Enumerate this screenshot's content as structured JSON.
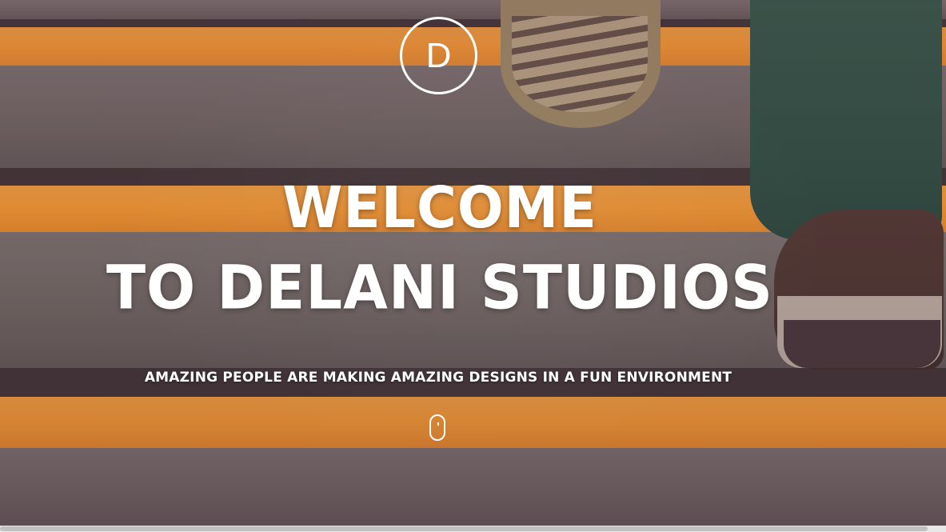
{
  "hero": {
    "logo_letter": "D",
    "title_line1": "WELCOME",
    "title_line2": "TO DELANI STUDIOS",
    "tagline": "AMAZING PEOPLE ARE MAKING AMAZING DESIGNS IN A FUN ENVIRONMENT",
    "scroll_icon": "mouse-scroll-icon"
  },
  "colors": {
    "text": "#ffffff",
    "stripe": "#f39b2f",
    "stair": "#6e6a63"
  }
}
